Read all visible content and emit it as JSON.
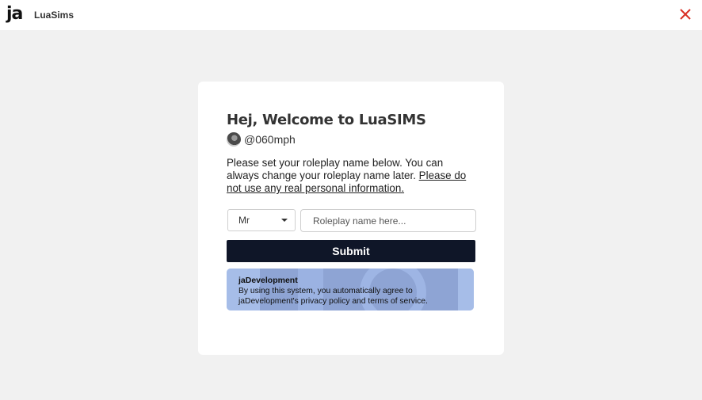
{
  "app": {
    "logo_text": "ja",
    "name": "LuaSims"
  },
  "colors": {
    "close_icon": "#d93025",
    "submit_bg": "#0f1628",
    "notice_bg": "#a6bde8",
    "page_bg": "#f1f1f1"
  },
  "icons": {
    "close": "close-icon",
    "dropdown": "chevron-down-icon"
  },
  "welcome": {
    "title": "Hej, Welcome to LuaSIMS",
    "handle": "@060mph",
    "info_text": "Please set your roleplay name below. You can always change your roleplay name later. ",
    "info_link": "Please do not use any real personal information."
  },
  "form": {
    "title_select_value": "Mr",
    "name_placeholder": "Roleplay name here...",
    "name_value": "",
    "submit_label": "Submit"
  },
  "notice": {
    "title": "jaDevelopment",
    "text": "By using this system, you automatically agree to jaDevelopment's privacy policy and terms of service."
  }
}
